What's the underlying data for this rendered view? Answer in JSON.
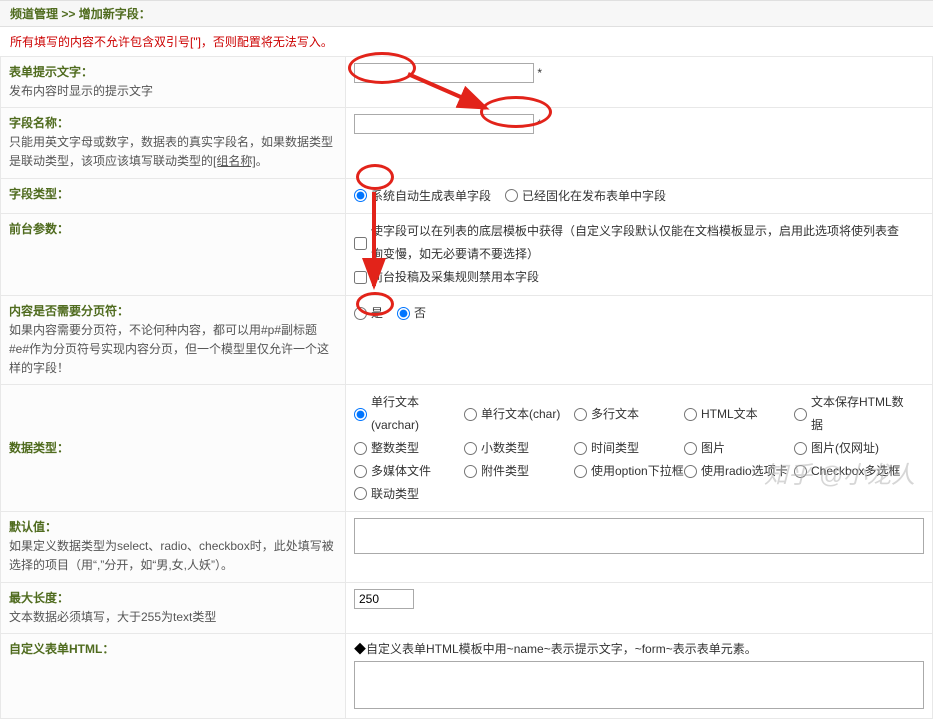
{
  "breadcrumb": {
    "section": "频道管理",
    "sep": ">>",
    "page": "增加新字段："
  },
  "warning": "所有填写的内容不允许包含双引号[\"]，否则配置将无法写入。",
  "rows": {
    "formTip": {
      "title": "表单提示文字：",
      "desc": "发布内容时显示的提示文字",
      "value": "",
      "star": "*"
    },
    "fieldName": {
      "title": "字段名称：",
      "desc": "只能用英文字母或数字，数据表的真实字段名，如果数据类型是联动类型，该项应该填写联动类型的[组名称]。",
      "value": "",
      "star": "*"
    },
    "fieldType": {
      "title": "字段类型：",
      "opt1": "系统自动生成表单字段",
      "opt2": "已经固化在发布表单中字段"
    },
    "frontArg": {
      "title": "前台参数：",
      "chk1": "使字段可以在列表的底层模板中获得（自定义字段默认仅能在文档模板显示，启用此选项将使列表查询变慢，如无必要请不要选择）",
      "chk2": "前台投稿及采集规则禁用本字段"
    },
    "page": {
      "title": "内容是否需要分页符：",
      "desc": "如果内容需要分页符，不论何种内容，都可以用#p#副标题#e#作为分页符号实现内容分页，但一个模型里仅允许一个这样的字段！",
      "yes": "是",
      "no": "否"
    },
    "dataType": {
      "title": "数据类型：",
      "opts": [
        "单行文本(varchar)",
        "单行文本(char)",
        "多行文本",
        "HTML文本",
        "文本保存HTML数据",
        "整数类型",
        "小数类型",
        "时间类型",
        "图片",
        "图片(仅网址)",
        "多媒体文件",
        "附件类型",
        "使用option下拉框",
        "使用radio选项卡",
        "Checkbox多选框",
        "联动类型"
      ]
    },
    "default": {
      "title": "默认值：",
      "desc": "如果定义数据类型为select、radio、checkbox时，此处填写被选择的项目（用“,”分开，如“男,女,人妖”）。",
      "value": ""
    },
    "maxlen": {
      "title": "最大长度：",
      "desc": "文本数据必须填写，大于255为text类型",
      "value": "250"
    },
    "customHtml": {
      "title": "自定义表单HTML：",
      "desc_prefix": "◆",
      "desc": "自定义表单HTML模板中用~name~表示提示文字，~form~表示表单元素。"
    }
  },
  "watermark": "知乎 @小龙人"
}
